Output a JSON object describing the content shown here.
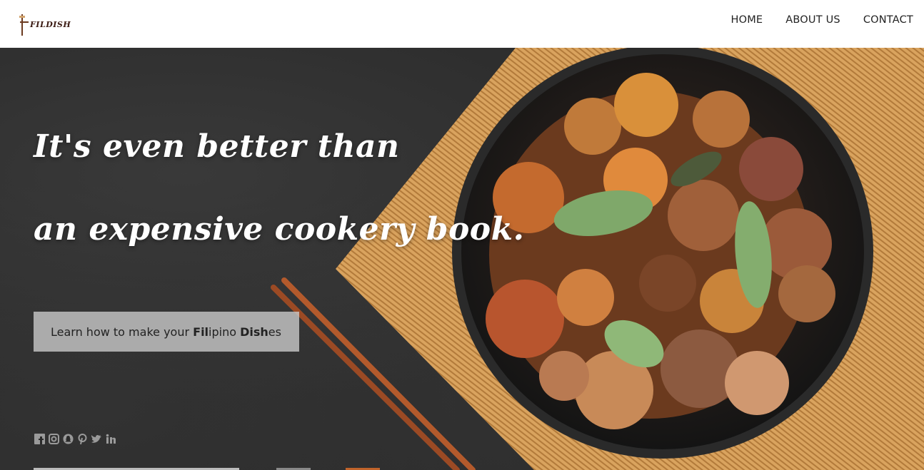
{
  "header": {
    "logo_text": "FILDISH",
    "nav": [
      {
        "label": "HOME"
      },
      {
        "label": "ABOUT US"
      },
      {
        "label": "CONTACT"
      }
    ]
  },
  "hero": {
    "headline_line1": "It's even better than",
    "headline_line2": "an expensive cookery book.",
    "cta": {
      "prefix": "Learn how to make your ",
      "fil_bold": "Fil",
      "fil_rest": "ipino ",
      "dish_bold": "Dish",
      "dish_rest": "es"
    }
  },
  "social_icons": [
    "facebook-icon",
    "instagram-icon",
    "snapchat-icon",
    "pinterest-icon",
    "twitter-icon",
    "linkedin-icon"
  ],
  "colors": {
    "background_slate": "#2a2a2a",
    "mat": "#d9a35e",
    "bowl": "#1c1c1c",
    "chopsticks": "#a0522d"
  }
}
